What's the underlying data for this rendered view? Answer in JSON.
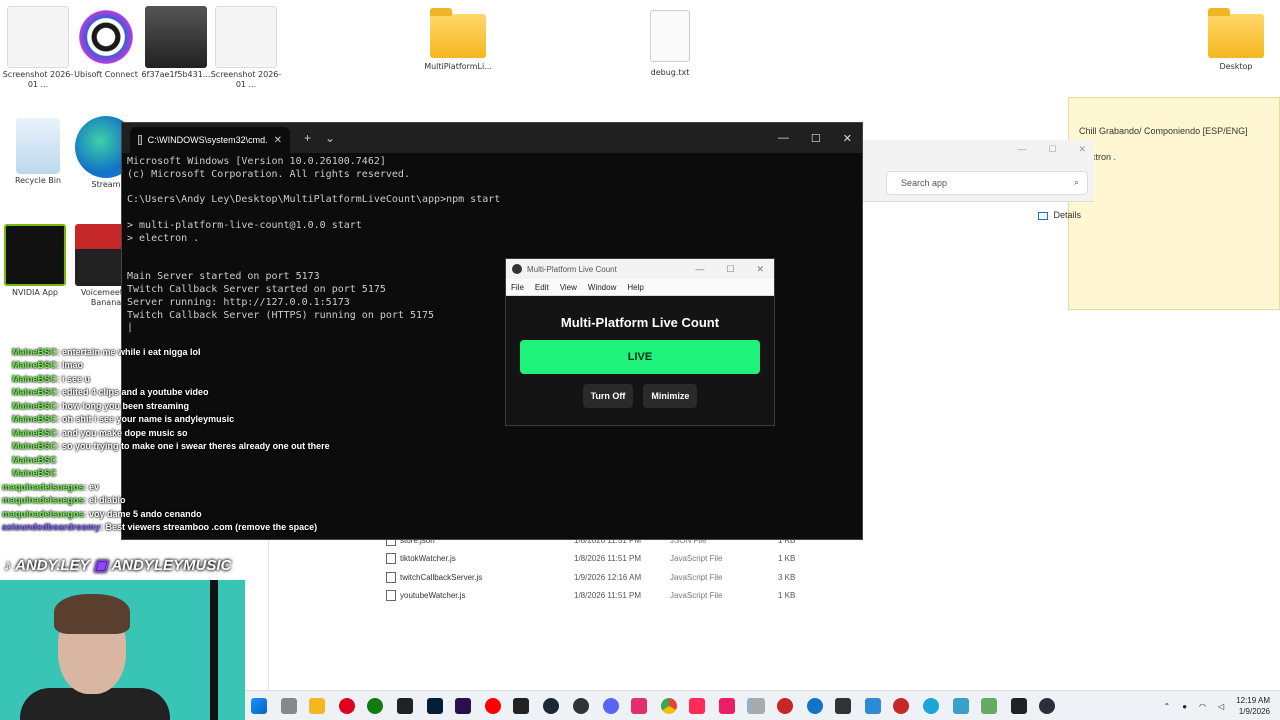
{
  "desktop": {
    "icons": [
      {
        "label": "Screenshot 2026-01 ..."
      },
      {
        "label": "Ubisoft Connect"
      },
      {
        "label": "6f37ae1f5b431..."
      },
      {
        "label": "Screenshot 2026-01 ..."
      },
      {
        "label": "MultiPlatformLi..."
      },
      {
        "label": "debug.txt"
      },
      {
        "label": "Desktop"
      },
      {
        "label": "Recycle Bin"
      },
      {
        "label": "Stream"
      },
      {
        "label": "NVIDIA App"
      },
      {
        "label": "Voicemeeter Banana"
      }
    ]
  },
  "sticky": {
    "line1": "Chill Grabando/ Componiendo [ESP/ENG]",
    "line2": "electron ."
  },
  "explorer": {
    "search_placeholder": "Search app",
    "details_label": "Details",
    "files": [
      {
        "name": "store.json",
        "date": "1/8/2026 11:51 PM",
        "type": "JSON File",
        "size": "1 KB"
      },
      {
        "name": "tiktokWatcher.js",
        "date": "1/8/2026 11:51 PM",
        "type": "JavaScript File",
        "size": "1 KB"
      },
      {
        "name": "twitchCallbackServer.js",
        "date": "1/9/2026 12:16 AM",
        "type": "JavaScript File",
        "size": "3 KB"
      },
      {
        "name": "youtubeWatcher.js",
        "date": "1/8/2026 11:51 PM",
        "type": "JavaScript File",
        "size": "1 KB"
      }
    ]
  },
  "cmd": {
    "tab_title": "C:\\WINDOWS\\system32\\cmd.",
    "tab_close": "✕",
    "new_tab": "+",
    "dropdown": "⌄",
    "output": "Microsoft Windows [Version 10.0.26100.7462]\n(c) Microsoft Corporation. All rights reserved.\n\nC:\\Users\\Andy Ley\\Desktop\\MultiPlatformLiveCount\\app>npm start\n\n> multi-platform-live-count@1.0.0 start\n> electron .\n\n\nMain Server started on port 5173\nTwitch Callback Server started on port 5175\nServer running: http://127.0.0.1:5173\nTwitch Callback Server (HTTPS) running on port 5175\n|"
  },
  "app": {
    "window_title": "Multi-Platform Live Count",
    "menu": [
      "File",
      "Edit",
      "View",
      "Window",
      "Help"
    ],
    "heading": "Multi-Platform Live Count",
    "live_label": "LIVE",
    "turn_off_label": "Turn Off",
    "minimize_label": "Minimize",
    "live_color": "#1ef17c"
  },
  "chat": [
    {
      "user": "MaineBSC",
      "msg": "entertain me while i eat nigga lol"
    },
    {
      "user": "MaineBSC",
      "msg": "lmao"
    },
    {
      "user": "MaineBSC",
      "msg": "i see u"
    },
    {
      "user": "MaineBSC",
      "msg": "edited 4 clips and a youtube video"
    },
    {
      "user": "MaineBSC",
      "msg": "how long you been streaming"
    },
    {
      "user": "MaineBSC",
      "msg": "oh shit i see your name is andyleymusic"
    },
    {
      "user": "MaineBSC",
      "msg": "and you make dope music so"
    },
    {
      "user": "MaineBSC",
      "msg": "so you trying to make one i swear theres already one out there"
    },
    {
      "user": "MaineBSC",
      "msg": ""
    },
    {
      "user": "MaineBSC",
      "msg": ""
    },
    {
      "user": "maquinadelsuegos",
      "msg": "ev"
    },
    {
      "user": "maquinadelsuegos",
      "msg": "el diablo"
    },
    {
      "user": "maquinadelsuegos",
      "msg": "voy dame 5 ando cenando"
    },
    {
      "user": "astoundedboardroomy",
      "msg": "Best viewers streamboo .com (remove the space)"
    }
  ],
  "stream": {
    "brand_left": "ANDY.LEY",
    "brand_right": "ANDYLEYMUSIC"
  },
  "taskbar": {
    "time": "12:19 AM",
    "date": "1/9/2026",
    "tray_chevron": "⌃"
  }
}
